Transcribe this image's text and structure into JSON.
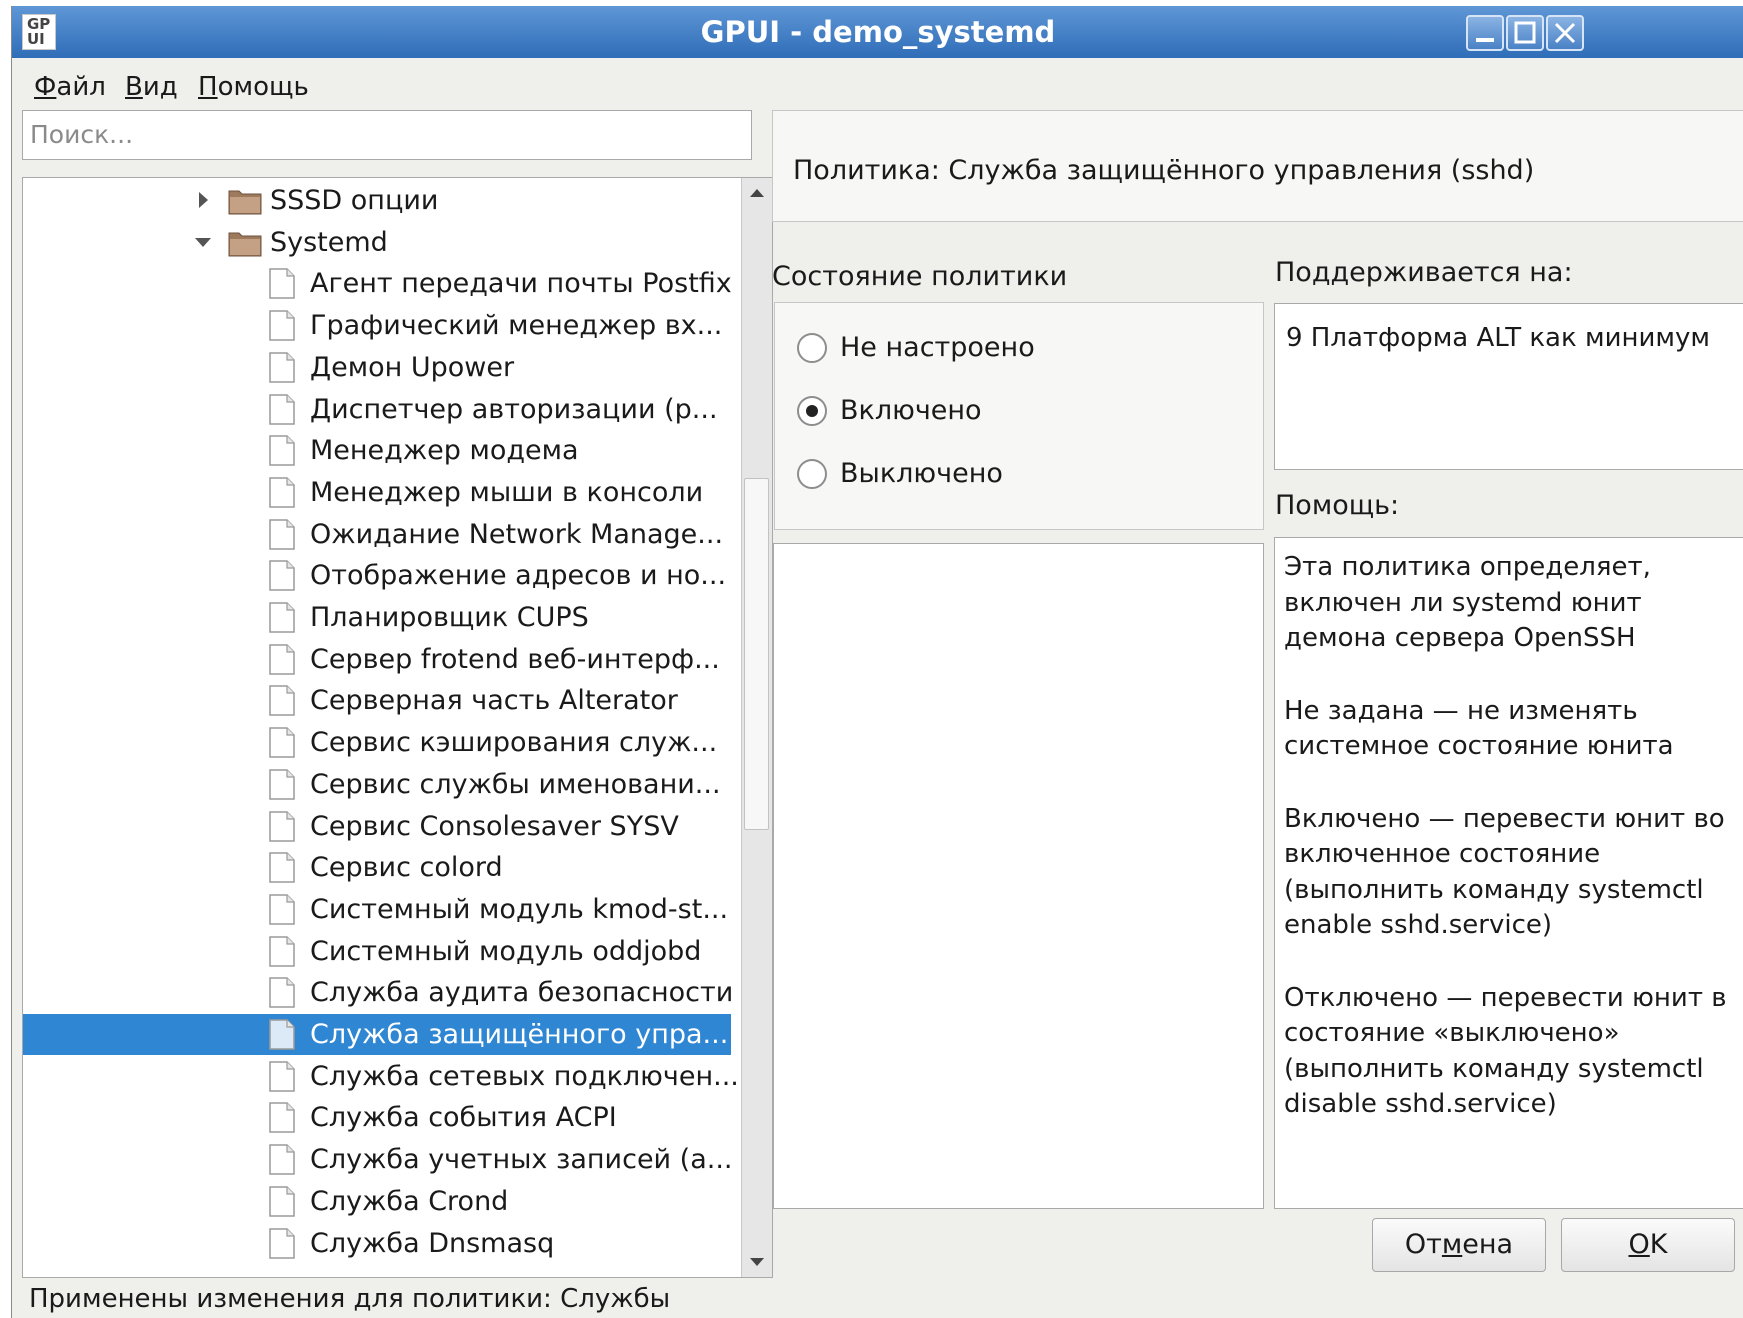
{
  "window": {
    "app_icon": "GP UI",
    "title": "GPUI - demo_systemd"
  },
  "menu": {
    "file": {
      "accel": "Ф",
      "rest": "айл"
    },
    "view": {
      "accel": "В",
      "rest": "ид"
    },
    "help": {
      "accel": "П",
      "rest": "омощь"
    }
  },
  "search": {
    "placeholder": "Поиск..."
  },
  "tree": {
    "folders": [
      {
        "label": "SSSD опции",
        "expanded": false
      },
      {
        "label": "Systemd",
        "expanded": true
      }
    ],
    "items": [
      "Агент передачи почты Postfix",
      "Графический менеджер вх...",
      "Демон Upower",
      "Диспетчер авторизации (р...",
      "Менеджер модема",
      "Менеджер мыши в консоли",
      "Ожидание Network Manage...",
      "Отображение адресов и но...",
      "Планировщик CUPS",
      "Сервер frotend веб-интерф...",
      "Серверная часть Alterator",
      "Сервис кэширования служ...",
      "Сервис службы именовани...",
      "Сервис Consolesaver SYSV",
      "Сервис colord",
      "Системный модуль kmod-st...",
      "Системный модуль oddjobd",
      "Служба аудита безопасности",
      "Служба защищённого упра...",
      "Служба сетевых подключен...",
      "Служба события ACPI",
      "Служба учетных записей (а...",
      "Служба Crond",
      "Служба Dnsmasq"
    ],
    "selected_index": 18
  },
  "policy": {
    "title": "Политика: Служба защищённого управления (sshd)",
    "state_label": "Состояние политики",
    "states": [
      "Не настроено",
      "Включено",
      "Выключено"
    ],
    "selected_state": 1,
    "supported_label": "Поддерживается на:",
    "supported_value": "9 Платформа ALT как минимум",
    "help_label": "Помощь:",
    "help_paragraphs": [
      "Эта политика определяет, включен ли systemd юнит демона сервера OpenSSH",
      "Не задана — не изменять системное состояние юнита",
      "Включено — перевести юнит во включенное состояние (выполнить команду systemctl enable sshd.service)",
      "Отключено — перевести юнит в состояние «выключено» (выполнить команду systemctl disable sshd.service)"
    ]
  },
  "buttons": {
    "cancel": {
      "pre": "От",
      "accel": "м",
      "post": "ена"
    },
    "ok": {
      "pre": "",
      "accel": "O",
      "post": "K"
    }
  },
  "status": "Применены изменения для политики: Службы",
  "colors": {
    "titlebar": "#2f6db8",
    "selection": "#2f86d2",
    "window_bg": "#efefec"
  }
}
